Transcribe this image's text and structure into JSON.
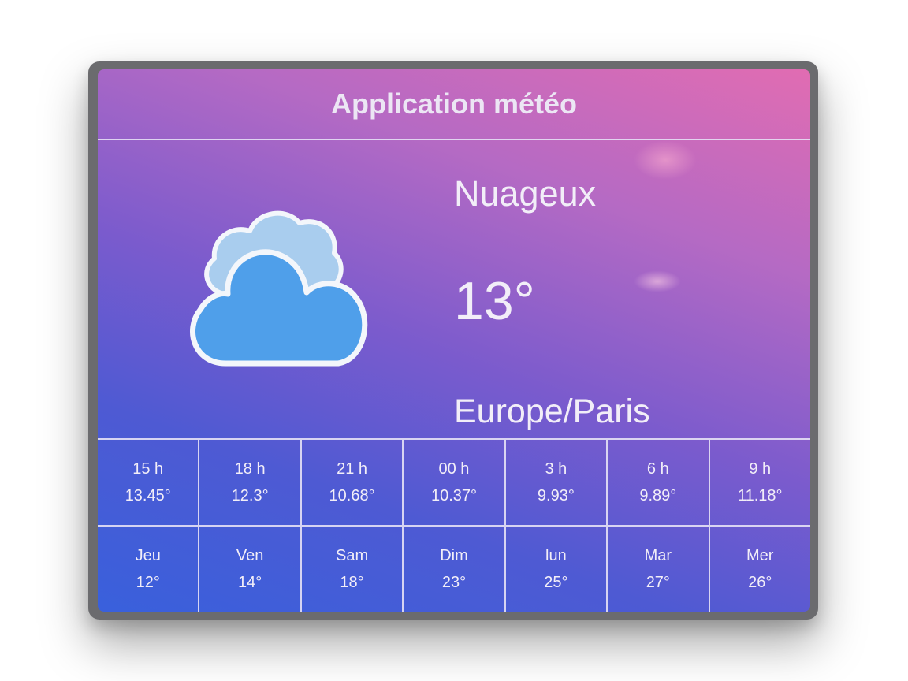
{
  "app": {
    "title": "Application météo"
  },
  "current": {
    "icon": "cloud-icon",
    "condition": "Nuageux",
    "temperature": "13°",
    "location": "Europe/Paris"
  },
  "hourly": [
    {
      "time": "15 h",
      "temp": "13.45°"
    },
    {
      "time": "18 h",
      "temp": "12.3°"
    },
    {
      "time": "21 h",
      "temp": "10.68°"
    },
    {
      "time": "00 h",
      "temp": "10.37°"
    },
    {
      "time": "3 h",
      "temp": "9.93°"
    },
    {
      "time": "6 h",
      "temp": "9.89°"
    },
    {
      "time": "9 h",
      "temp": "11.18°"
    }
  ],
  "daily": [
    {
      "day": "Jeu",
      "temp": "12°"
    },
    {
      "day": "Ven",
      "temp": "14°"
    },
    {
      "day": "Sam",
      "temp": "18°"
    },
    {
      "day": "Dim",
      "temp": "23°"
    },
    {
      "day": "lun",
      "temp": "25°"
    },
    {
      "day": "Mar",
      "temp": "27°"
    },
    {
      "day": "Mer",
      "temp": "26°"
    }
  ],
  "colors": {
    "gradient_top_right": "#e16cb2",
    "gradient_bottom_left": "#3960dc",
    "cloud_fill": "#4f9fea",
    "cloud_back_fill": "#a9cdee",
    "cloud_outline": "#f3f6fb",
    "bezel": "#6b6b6e"
  }
}
